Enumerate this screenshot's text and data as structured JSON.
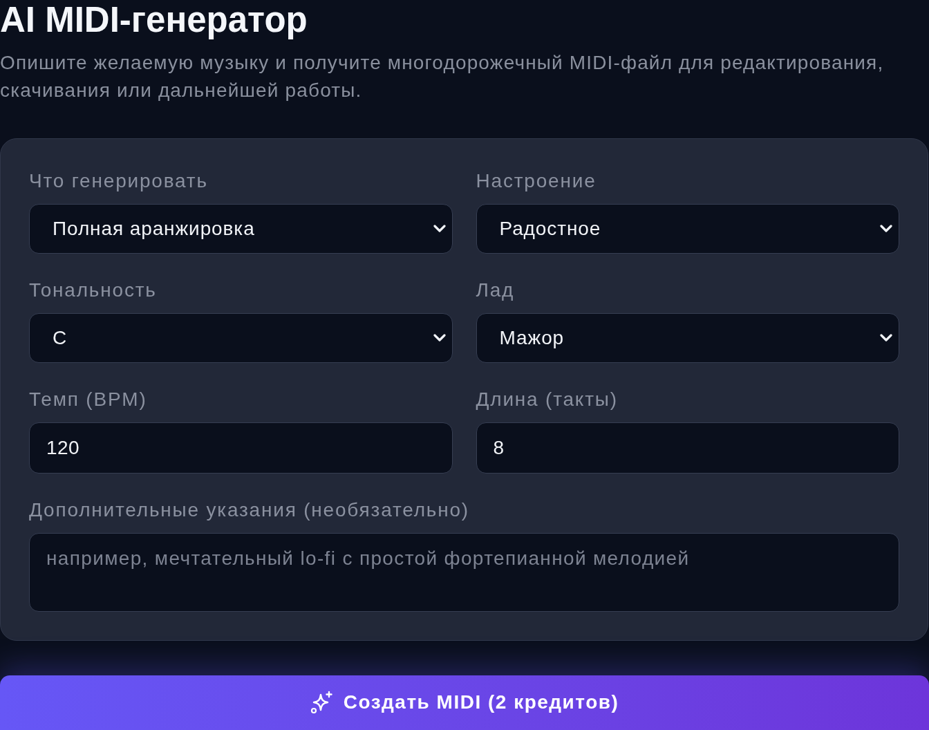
{
  "header": {
    "title": "AI MIDI-генератор",
    "description": "Опишите желаемую музыку и получите многодорожечный MIDI-файл для редактирования, скачивания или дальнейшей работы."
  },
  "form": {
    "fields": [
      {
        "kind": "select",
        "label": "Что генерировать",
        "value": "Полная аранжировка"
      },
      {
        "kind": "select",
        "label": "Настроение",
        "value": "Радостное"
      },
      {
        "kind": "select",
        "label": "Тональность",
        "value": "C"
      },
      {
        "kind": "select",
        "label": "Лад",
        "value": "Мажор"
      },
      {
        "kind": "input",
        "label": "Темп (BPM)",
        "value": "120"
      },
      {
        "kind": "input",
        "label": "Длина (такты)",
        "value": "8"
      },
      {
        "kind": "textarea",
        "label": "Дополнительные указания (необязательно)",
        "placeholder": "например, мечтательный lo-fi с простой фортепианной мелодией"
      }
    ]
  },
  "generate_button": {
    "label": "Создать MIDI (2 кредитов)"
  }
}
